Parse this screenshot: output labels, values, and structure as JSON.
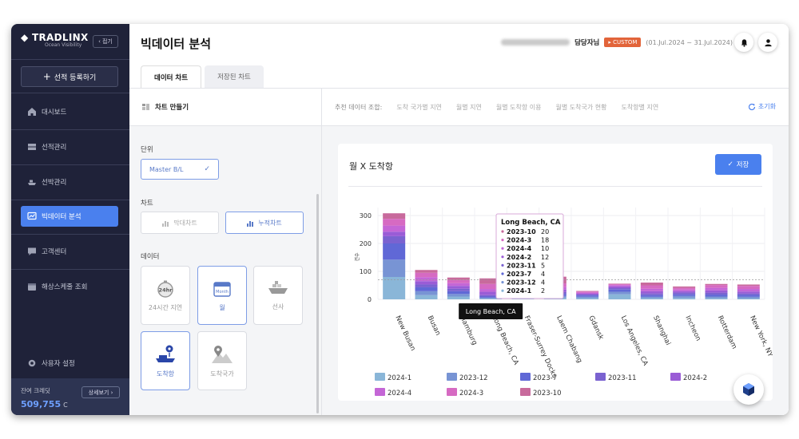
{
  "sidebar": {
    "logo": "TRADLINX",
    "logo_sub": "Ocean Visibility",
    "fold_label": "접기",
    "register_label": "선적 등록하기",
    "items": [
      {
        "label": "대시보드",
        "icon": "home-icon",
        "active": false
      },
      {
        "label": "선적관리",
        "icon": "shipment-icon",
        "active": false
      },
      {
        "label": "선박관리",
        "icon": "vessel-icon",
        "active": false
      },
      {
        "label": "빅데이터 분석",
        "icon": "analytics-icon",
        "active": true
      },
      {
        "label": "고객센터",
        "icon": "support-icon",
        "active": false
      },
      {
        "label": "해상스케줄 조회",
        "icon": "calendar-icon",
        "active": false
      }
    ],
    "settings_label": "사용자 설정",
    "credit_label": "잔여 크레딧",
    "credit_value": "509,755",
    "credit_unit": "C",
    "detail_label": "상세보기"
  },
  "header": {
    "title": "빅데이터 분석",
    "user_suffix": "담당자님",
    "badge": "CUSTOM",
    "period": "(01.Jul.2024 ~ 31.Jul.2024)"
  },
  "tabs": [
    {
      "label": "데이터 차트",
      "active": true
    },
    {
      "label": "저장된 차트",
      "active": false
    }
  ],
  "builder": {
    "title": "차트 만들기",
    "unit_label": "단위",
    "unit_value": "Master B/L",
    "chart_label": "차트",
    "chart_types": [
      "막대차트",
      "누적차트"
    ],
    "data_label": "데이터",
    "data_options": [
      {
        "label": "24시간 지연",
        "selected": false
      },
      {
        "label": "월",
        "selected": true
      },
      {
        "label": "선사",
        "selected": false
      },
      {
        "label": "도착항",
        "selected": true
      },
      {
        "label": "도착국가",
        "selected": false
      }
    ]
  },
  "recommend": {
    "label": "추천 데이터 조합:",
    "items": [
      "도착 국가별 지연",
      "월별 지연",
      "월별 도착항 이용",
      "월별 도착국가 현황",
      "도착항별 지연"
    ],
    "reset": "초기화"
  },
  "card": {
    "title": "월 X 도착항",
    "save": "저장"
  },
  "chart_data": {
    "type": "bar",
    "stacked": true,
    "ylabel": "건수",
    "ylim": [
      0,
      330
    ],
    "yticks": [
      0,
      100,
      200,
      300
    ],
    "categories": [
      "New Busan",
      "Busan",
      "Hamburg",
      "Long Beach, CA",
      "Fraser-Surrey Docks",
      "Laem Chabang",
      "Gdansk",
      "Los Angeles, CA",
      "Shanghai",
      "Incheon",
      "Rotterdam",
      "New York, NY"
    ],
    "series": [
      {
        "name": "2024-1",
        "color": "#8ab6d8",
        "values": [
          80,
          15,
          10,
          2,
          4,
          6,
          4,
          18,
          4,
          5,
          4,
          3
        ]
      },
      {
        "name": "2023-12",
        "color": "#7894d4",
        "values": [
          62,
          14,
          9,
          4,
          4,
          6,
          5,
          9,
          5,
          7,
          6,
          6
        ]
      },
      {
        "name": "2023-7",
        "color": "#6068d6",
        "values": [
          58,
          14,
          10,
          4,
          5,
          7,
          5,
          8,
          6,
          6,
          7,
          7
        ]
      },
      {
        "name": "2023-11",
        "color": "#7a62d0",
        "values": [
          26,
          10,
          9,
          5,
          4,
          7,
          3,
          5,
          6,
          6,
          7,
          5
        ]
      },
      {
        "name": "2024-2",
        "color": "#9a5cd6",
        "values": [
          16,
          12,
          10,
          12,
          6,
          9,
          3,
          6,
          8,
          5,
          8,
          7
        ]
      },
      {
        "name": "2024-4",
        "color": "#c466d6",
        "values": [
          22,
          14,
          10,
          10,
          7,
          10,
          4,
          5,
          9,
          6,
          9,
          9
        ]
      },
      {
        "name": "2024-3",
        "color": "#d66ac2",
        "values": [
          24,
          16,
          11,
          18,
          8,
          12,
          4,
          3,
          12,
          6,
          10,
          11
        ]
      },
      {
        "name": "2023-10",
        "color": "#c86a9c",
        "values": [
          20,
          10,
          9,
          20,
          8,
          24,
          2,
          2,
          10,
          5,
          4,
          5
        ]
      }
    ],
    "tooltip": {
      "title": "Long Beach, CA",
      "rows": [
        {
          "name": "2023-10",
          "value": "20"
        },
        {
          "name": "2024-3",
          "value": "18"
        },
        {
          "name": "2024-4",
          "value": "10"
        },
        {
          "name": "2024-2",
          "value": "12"
        },
        {
          "name": "2023-11",
          "value": "5"
        },
        {
          "name": "2023-7",
          "value": "4"
        },
        {
          "name": "2023-12",
          "value": "4"
        },
        {
          "name": "2024-1",
          "value": "2"
        }
      ]
    },
    "hover_label": "Long Beach, CA",
    "reference_line": 70
  }
}
